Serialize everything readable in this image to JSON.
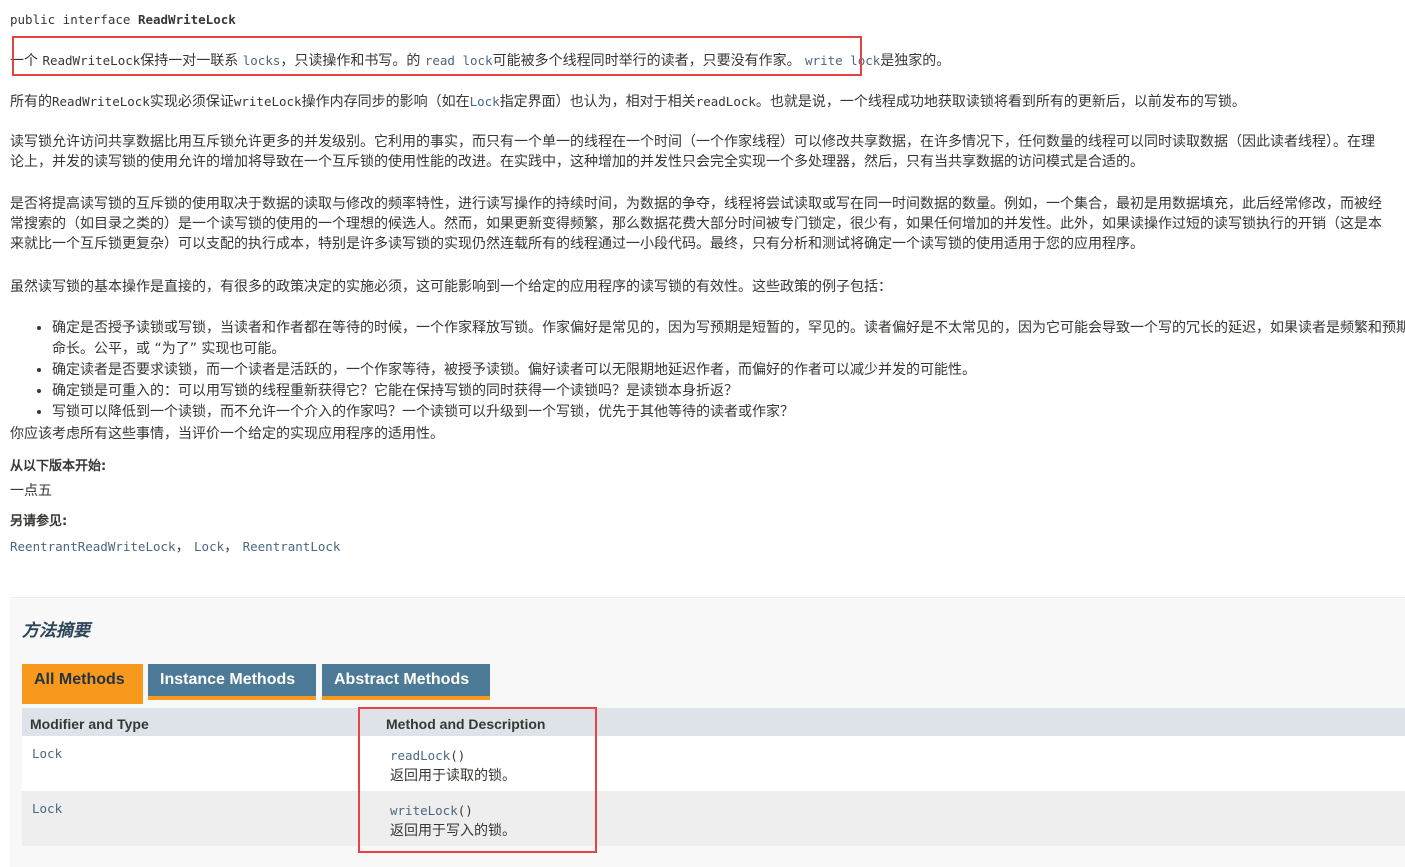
{
  "declaration": {
    "prefix": "public interface ",
    "name": "ReadWriteLock"
  },
  "intro": {
    "p1": "一个 ",
    "c1": "ReadWriteLock",
    "p2": "保持一对一联系 ",
    "c2": "locks",
    "p3": "，只读操作和书写。的 ",
    "c3": "read lock",
    "p4": "可能被多个线程同时举行的读者，只要没有作家。 ",
    "c4": "write lock",
    "p5": "是独家的。"
  },
  "para2": {
    "t1": "所有的",
    "c1": "ReadWriteLock",
    "t2": "实现必须保证",
    "c2": "writeLock",
    "t3": "操作内存同步的影响（如在",
    "c3": "Lock",
    "t4": "指定界面）也认为，相对于相关",
    "c4": "readLock",
    "t5": "。也就是说，一个线程成功地获取读锁将看到所有的更新后，以前发布的写锁。"
  },
  "para3": "读写锁允许访问共享数据比用互斥锁允许更多的并发级别。它利用的事实，而只有一个单一的线程在一个时间（一个作家线程）可以修改共享数据，在许多情况下，任何数量的线程可以同时读取数据（因此读者线程）。在理论上，并发的读写锁的使用允许的增加将导致在一个互斥锁的使用性能的改进。在实践中，这种增加的并发性只会完全实现一个多处理器，然后，只有当共享数据的访问模式是合适的。",
  "para4": "是否将提高读写锁的互斥锁的使用取决于数据的读取与修改的频率特性，进行读写操作的持续时间，为数据的争夺，线程将尝试读取或写在同一时间数据的数量。例如，一个集合，最初是用数据填充，此后经常修改，而被经常搜索的（如目录之类的）是一个读写锁的使用的一个理想的候选人。然而，如果更新变得频繁，那么数据花费大部分时间被专门锁定，很少有，如果任何增加的并发性。此外，如果读操作过短的读写锁执行的开销（这是本来就比一个互斥锁更复杂）可以支配的执行成本，特别是许多读写锁的实现仍然连载所有的线程通过一小段代码。最终，只有分析和测试将确定一个读写锁的使用适用于您的应用程序。",
  "para5": "虽然读写锁的基本操作是直接的，有很多的政策决定的实施必须，这可能影响到一个给定的应用程序的读写锁的有效性。这些政策的例子包括：",
  "policies": [
    "确定是否授予读锁或写锁，当读者和作者都在等待的时候，一个作家释放写锁。作家偏好是常见的，因为写预期是短暂的，罕见的。读者偏好是不太常见的，因为它可能会导致一个写的冗长的延迟，如果读者是频繁和预期寿命长。公平，或 “为了” 实现也可能。",
    "确定读者是否要求读锁，而一个读者是活跃的，一个作家等待，被授予读锁。偏好读者可以无限期地延迟作者，而偏好的作者可以减少并发的可能性。",
    "确定锁是可重入的：可以用写锁的线程重新获得它？它能在保持写锁的同时获得一个读锁吗？是读锁本身折返？",
    "写锁可以降低到一个读锁，而不允许一个介入的作家吗？一个读锁可以升级到一个写锁，优先于其他等待的读者或作家？"
  ],
  "para6": "你应该考虑所有这些事情，当评价一个给定的实现应用程序的适用性。",
  "since": {
    "heading": "从以下版本开始:",
    "value": "一点五"
  },
  "see_also": {
    "heading": "另请参见:",
    "links": [
      "ReentrantReadWriteLock",
      "Lock",
      "ReentrantLock"
    ],
    "sep": "，"
  },
  "summary": {
    "title": "方法摘要",
    "tabs": [
      "All Methods",
      "Instance Methods",
      "Abstract Methods"
    ],
    "headers": [
      "Modifier and Type",
      "Method and Description"
    ],
    "rows": [
      {
        "type": "Lock",
        "method": "readLock",
        "parens": "()",
        "desc": "返回用于读取的锁。"
      },
      {
        "type": "Lock",
        "method": "writeLock",
        "parens": "()",
        "desc": "返回用于写入的锁。"
      }
    ]
  },
  "colors": {
    "link": "#4a6782",
    "tab_active": "#f8981d",
    "tab_inactive": "#4d7a97",
    "highlight_box": "#e84343"
  }
}
